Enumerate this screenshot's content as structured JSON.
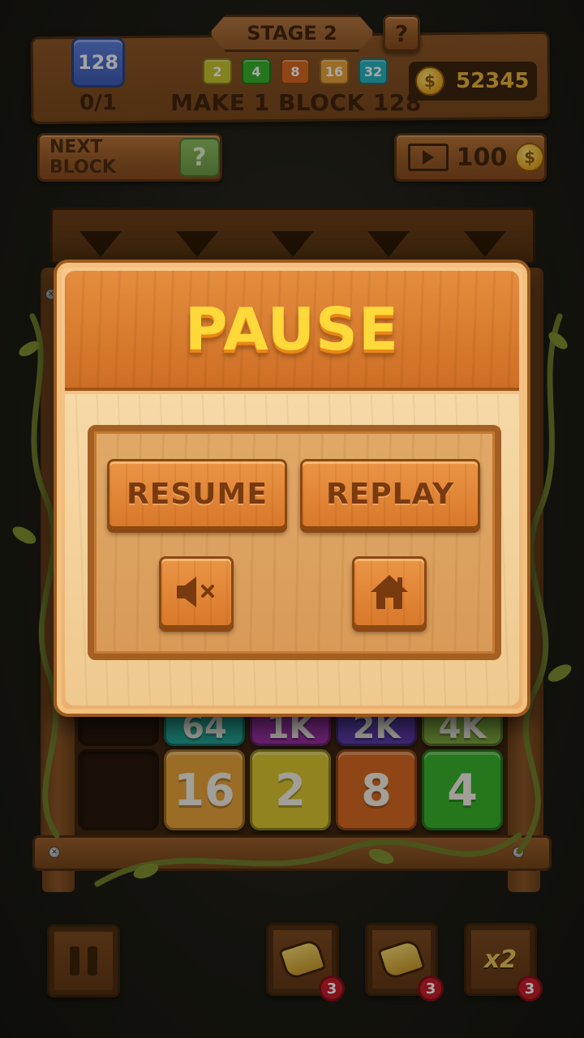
{
  "header": {
    "stage_label": "STAGE 2",
    "help_label": "?",
    "target_block": "128",
    "target_progress": "0/1",
    "goal_text": "MAKE 1 BLOCK 128",
    "coins": "52345",
    "coin_symbol": "$",
    "chips": [
      {
        "label": "2",
        "color": "#c5c42e"
      },
      {
        "label": "4",
        "color": "#37b12c"
      },
      {
        "label": "8",
        "color": "#d8661f"
      },
      {
        "label": "16",
        "color": "#e8a23a"
      },
      {
        "label": "32",
        "color": "#22b3c2"
      }
    ]
  },
  "toolbar": {
    "next_block_label": "NEXT BLOCK",
    "next_block_preview": "?",
    "video_reward": "100",
    "coin_symbol": "$"
  },
  "board": {
    "bottom_row": [
      {
        "value": "",
        "color": ""
      },
      {
        "value": "16",
        "color": "#e8a23a"
      },
      {
        "value": "2",
        "color": "#d9c530"
      },
      {
        "value": "8",
        "color": "#d8661f"
      },
      {
        "value": "4",
        "color": "#37b12c"
      }
    ],
    "partial_row": [
      {
        "value": "",
        "color": ""
      },
      {
        "value": "64",
        "color": "#1fa89a"
      },
      {
        "value": "1K",
        "color": "#9b2fa8"
      },
      {
        "value": "2K",
        "color": "#5b3ab0"
      },
      {
        "value": "4K",
        "color": "#7fa840"
      }
    ]
  },
  "pause_dialog": {
    "title": "PAUSE",
    "resume_label": "RESUME",
    "replay_label": "REPLAY",
    "sound_icon": "mute-icon",
    "home_icon": "home-icon"
  },
  "bottom_bar": {
    "pause_icon": "pause-icon",
    "tools": [
      {
        "icon": "hammer-icon",
        "count": "3"
      },
      {
        "icon": "swap-hammer-icon",
        "count": "3"
      },
      {
        "icon": "x2-icon",
        "label": "x2",
        "count": "3"
      }
    ]
  },
  "colors": {
    "title_yellow": "#ffd93a",
    "wood_orange": "#d8782a",
    "badge_red": "#c6192a"
  }
}
